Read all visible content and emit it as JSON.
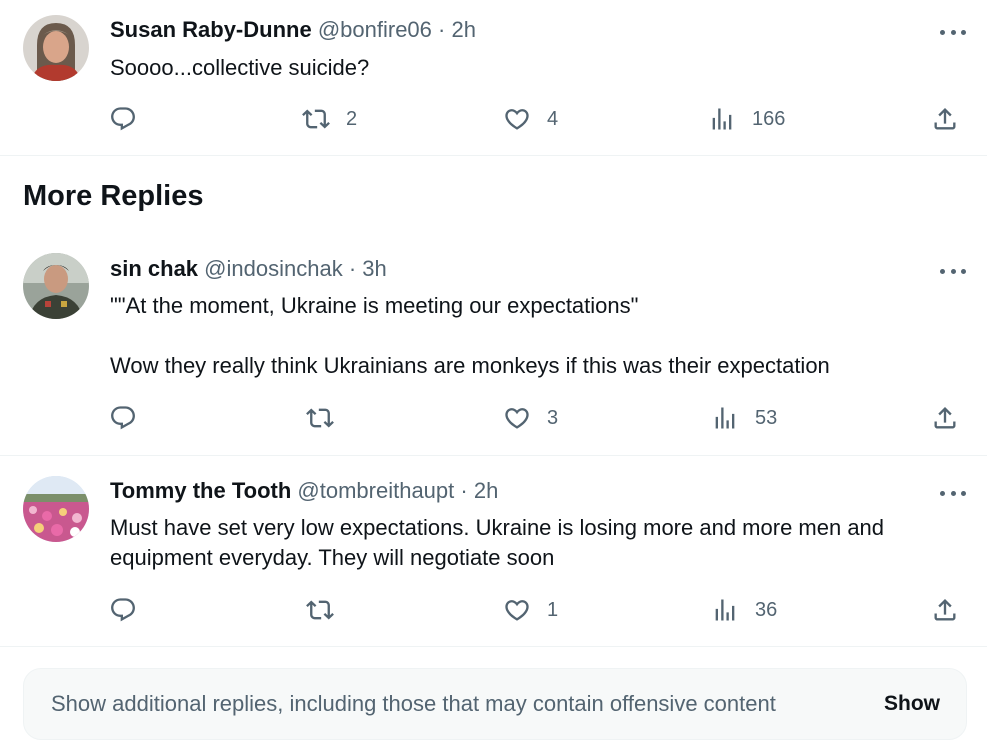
{
  "tweets": [
    {
      "name": "Susan Raby-Dunne",
      "handle": "@bonfire06",
      "dot": "·",
      "time": "2h",
      "lines": [
        "Soooo...collective suicide?"
      ],
      "replies": "",
      "retweets": "2",
      "likes": "4",
      "views": "166"
    },
    {
      "name": "sin chak",
      "handle": "@indosinchak",
      "dot": "·",
      "time": "3h",
      "lines": [
        "\"\"At the moment, Ukraine is meeting our expectations\"",
        "Wow they really think Ukrainians are monkeys if this was their expectation"
      ],
      "replies": "",
      "retweets": "",
      "likes": "3",
      "views": "53"
    },
    {
      "name": "Tommy the Tooth",
      "handle": "@tombreithaupt",
      "dot": "·",
      "time": "2h",
      "lines": [
        "Must have set very low expectations.  Ukraine is losing more and more men and",
        "equipment everyday.  They will negotiate soon"
      ],
      "replies": "",
      "retweets": "",
      "likes": "1",
      "views": "36"
    }
  ],
  "section": {
    "title": "More Replies"
  },
  "show_more": {
    "message": "Show additional replies, including those that may contain offensive content",
    "button": "Show"
  },
  "icons": [
    "reply-icon",
    "retweet-icon",
    "like-icon",
    "views-icon",
    "share-icon",
    "more-icon"
  ],
  "colors": {
    "text": "#0f1419",
    "secondary": "#536471",
    "divider": "#eff3f4",
    "panel": "#f7f9f9"
  }
}
